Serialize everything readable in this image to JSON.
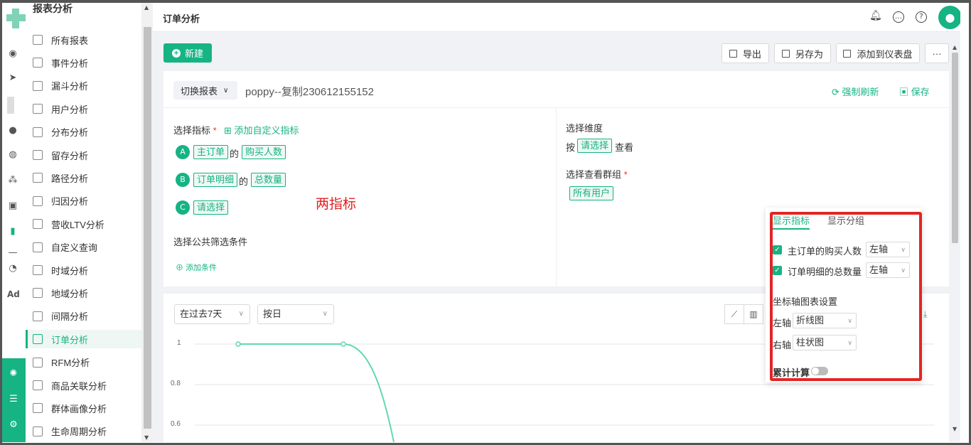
{
  "sidebar": {
    "title": "报表分析",
    "items": [
      {
        "label": "所有报表"
      },
      {
        "label": "事件分析"
      },
      {
        "label": "漏斗分析"
      },
      {
        "label": "用户分析"
      },
      {
        "label": "分布分析"
      },
      {
        "label": "留存分析"
      },
      {
        "label": "路径分析"
      },
      {
        "label": "归因分析"
      },
      {
        "label": "营收LTV分析"
      },
      {
        "label": "自定义查询"
      },
      {
        "label": "时域分析"
      },
      {
        "label": "地域分析"
      },
      {
        "label": "间隔分析"
      },
      {
        "label": "订单分析"
      },
      {
        "label": "RFM分析"
      },
      {
        "label": "商品关联分析"
      },
      {
        "label": "群体画像分析"
      },
      {
        "label": "生命周期分析"
      }
    ],
    "active_index": 13
  },
  "rail": {
    "ad_label": "Ad"
  },
  "header": {
    "title": "订单分析",
    "icons": [
      "bell-icon",
      "chat-icon",
      "help-icon",
      "user-avatar-icon"
    ]
  },
  "toolbar": {
    "new_label": "新建",
    "export_label": "导出",
    "save_as_label": "另存为",
    "add_dashboard_label": "添加到仪表盘",
    "more_label": "···"
  },
  "report": {
    "switch_label": "切换报表",
    "name": "poppy--复制230612155152",
    "refresh_label": "强制刷新",
    "save_label": "保存"
  },
  "metrics": {
    "section_label": "选择指标",
    "required_mark": "*",
    "add_custom_label": "添加自定义指标",
    "of_word": "的",
    "rows": [
      {
        "badge": "A",
        "entity": "主订单",
        "measure": "购买人数"
      },
      {
        "badge": "B",
        "entity": "订单明细",
        "measure": "总数量"
      },
      {
        "badge": "C",
        "entity": "请选择",
        "measure": ""
      }
    ],
    "annotation": "两指标",
    "filter_label": "选择公共筛选条件",
    "add_condition_label": "添加条件"
  },
  "dimension": {
    "section_label": "选择维度",
    "by_word": "按",
    "select_chip": "请选择",
    "view_word": "查看",
    "group_label": "选择查看群组",
    "group_chip": "所有用户"
  },
  "chart_controls": {
    "date_range": "在过去7天",
    "granularity": "按日"
  },
  "chart_data": {
    "type": "line",
    "y_ticks": [
      "1",
      "0.8",
      "0.6"
    ],
    "ylim": [
      0.6,
      1
    ],
    "series": [
      {
        "points": [
          {
            "x": 0,
            "y": 1
          },
          {
            "x": 1,
            "y": 1
          }
        ]
      }
    ],
    "line_color": "#5fd9ac",
    "grid": true
  },
  "popup": {
    "tabs": [
      "显示指标",
      "显示分组"
    ],
    "metrics": [
      {
        "label": "主订单的购买人数",
        "axis": "左轴",
        "checked": true
      },
      {
        "label": "订单明细的总数量",
        "axis": "左轴",
        "checked": true
      }
    ],
    "axis_settings_label": "坐标轴图表设置",
    "left_axis_label": "左轴",
    "left_axis_chart": "折线图",
    "right_axis_label": "右轴",
    "right_axis_chart": "柱状图",
    "cumulative_label": "累计计算",
    "cumulative_on": false
  },
  "colors": {
    "brand": "#16b383",
    "annotation": "#e02020",
    "highlight_border": "#e32525"
  }
}
